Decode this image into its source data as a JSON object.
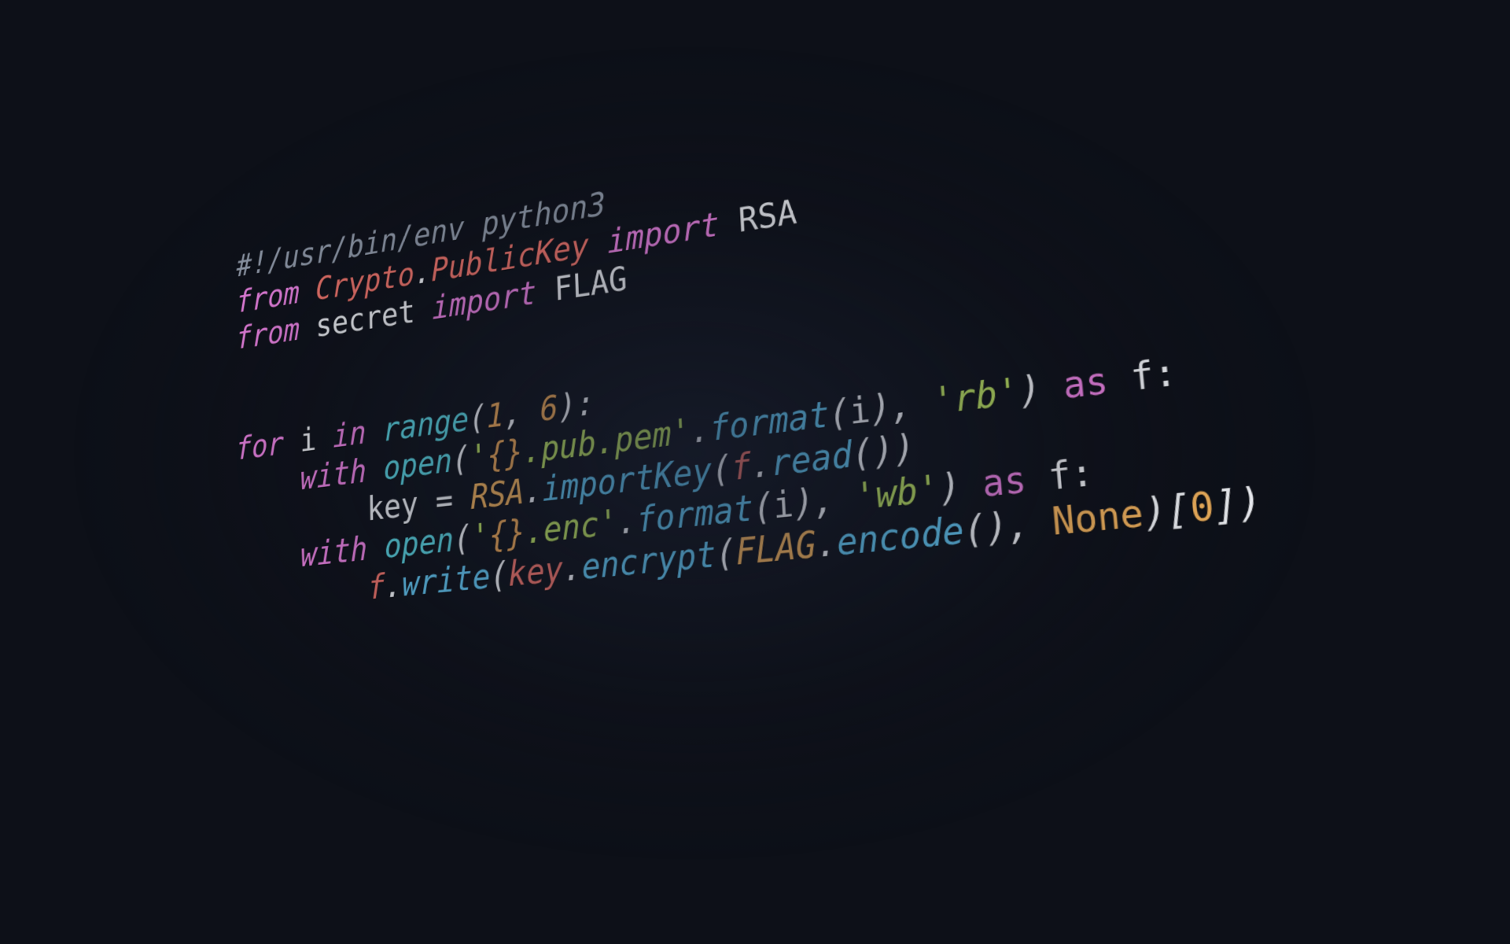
{
  "app": {
    "kind": "code-screenshot",
    "language": "Python",
    "background_color": "#0d1018"
  },
  "palette": {
    "background": "#0d1018",
    "comment": "#a9b3c4",
    "keyword": "#ef84e6",
    "module": "#f4766c",
    "variable": "#f4766c",
    "plain": "#f2f4f8",
    "function": "#63c9f5",
    "builtin": "#5ad6e3",
    "string": "#bce261",
    "format_brace": "#f0a957",
    "number": "#f0a957",
    "constant": "#f7b55d",
    "classname": "#f7b55d",
    "punctuation": "#f4f6fa"
  },
  "code": {
    "full_text": "#!/usr/bin/env python3\nfrom Crypto.PublicKey import RSA\nfrom secret import FLAG\n\n\nfor i in range(1, 6):\n    with open('{}.pub.pem'.format(i), 'rb') as f:\n        key = RSA.importKey(f.read())\n    with open('{}.enc'.format(i), 'wb') as f:\n        f.write(key.encrypt(FLAG.encode(), None)[0])",
    "lines": [
      {
        "n": 1,
        "text": "#!/usr/bin/env python3",
        "tokens": [
          {
            "t": "#!/usr/bin/env python3",
            "c": "comment"
          }
        ]
      },
      {
        "n": 2,
        "text": "from Crypto.PublicKey import RSA",
        "tokens": [
          {
            "t": "from",
            "c": "keyword"
          },
          {
            "t": " ",
            "c": "plain"
          },
          {
            "t": "Crypto",
            "c": "module"
          },
          {
            "t": ".",
            "c": "punct"
          },
          {
            "t": "PublicKey",
            "c": "module"
          },
          {
            "t": " ",
            "c": "plain"
          },
          {
            "t": "import",
            "c": "keyword"
          },
          {
            "t": " ",
            "c": "plain"
          },
          {
            "t": "RSA",
            "c": "plainup"
          }
        ]
      },
      {
        "n": 3,
        "text": "from secret import FLAG",
        "tokens": [
          {
            "t": "from",
            "c": "keyword"
          },
          {
            "t": " ",
            "c": "plain"
          },
          {
            "t": "secret",
            "c": "plainup"
          },
          {
            "t": " ",
            "c": "plain"
          },
          {
            "t": "import",
            "c": "keyword"
          },
          {
            "t": " ",
            "c": "plain"
          },
          {
            "t": "FLAG",
            "c": "plainup"
          }
        ]
      },
      {
        "n": 4,
        "text": "",
        "tokens": []
      },
      {
        "n": 5,
        "text": "",
        "tokens": []
      },
      {
        "n": 6,
        "text": "for i in range(1, 6):",
        "tokens": [
          {
            "t": "for",
            "c": "keyword"
          },
          {
            "t": " ",
            "c": "plain"
          },
          {
            "t": "i",
            "c": "plainup"
          },
          {
            "t": " ",
            "c": "plain"
          },
          {
            "t": "in",
            "c": "keyword"
          },
          {
            "t": " ",
            "c": "plain"
          },
          {
            "t": "range",
            "c": "builtin"
          },
          {
            "t": "(",
            "c": "punct"
          },
          {
            "t": "1",
            "c": "number"
          },
          {
            "t": ", ",
            "c": "punct"
          },
          {
            "t": "6",
            "c": "number"
          },
          {
            "t": "):",
            "c": "punct"
          }
        ]
      },
      {
        "n": 7,
        "text": "    with open('{}.pub.pem'.format(i), 'rb') as f:",
        "tokens": [
          {
            "t": "    ",
            "c": "plain"
          },
          {
            "t": "with",
            "c": "keyword"
          },
          {
            "t": " ",
            "c": "plain"
          },
          {
            "t": "open",
            "c": "builtin"
          },
          {
            "t": "(",
            "c": "punct"
          },
          {
            "t": "'",
            "c": "string"
          },
          {
            "t": "{}",
            "c": "brace"
          },
          {
            "t": ".pub.pem",
            "c": "string"
          },
          {
            "t": "'",
            "c": "string"
          },
          {
            "t": ".",
            "c": "punct"
          },
          {
            "t": "format",
            "c": "func"
          },
          {
            "t": "(",
            "c": "punct"
          },
          {
            "t": "i",
            "c": "plainup"
          },
          {
            "t": "), ",
            "c": "punct"
          },
          {
            "t": "'rb'",
            "c": "string"
          },
          {
            "t": ") ",
            "c": "punct"
          },
          {
            "t": "as",
            "c": "keyword2"
          },
          {
            "t": " ",
            "c": "plain"
          },
          {
            "t": "f:",
            "c": "plainup"
          }
        ]
      },
      {
        "n": 8,
        "text": "        key = RSA.importKey(f.read())",
        "tokens": [
          {
            "t": "        ",
            "c": "plain"
          },
          {
            "t": "key",
            "c": "plainup"
          },
          {
            "t": " = ",
            "c": "punct"
          },
          {
            "t": "RSA",
            "c": "class"
          },
          {
            "t": ".",
            "c": "punct"
          },
          {
            "t": "importKey",
            "c": "func"
          },
          {
            "t": "(",
            "c": "punct"
          },
          {
            "t": "f",
            "c": "var"
          },
          {
            "t": ".",
            "c": "punct"
          },
          {
            "t": "read",
            "c": "func"
          },
          {
            "t": "())",
            "c": "punct"
          }
        ]
      },
      {
        "n": 9,
        "text": "    with open('{}.enc'.format(i), 'wb') as f:",
        "tokens": [
          {
            "t": "    ",
            "c": "plain"
          },
          {
            "t": "with",
            "c": "keyword"
          },
          {
            "t": " ",
            "c": "plain"
          },
          {
            "t": "open",
            "c": "builtin"
          },
          {
            "t": "(",
            "c": "punct"
          },
          {
            "t": "'",
            "c": "string"
          },
          {
            "t": "{}",
            "c": "brace"
          },
          {
            "t": ".enc",
            "c": "string"
          },
          {
            "t": "'",
            "c": "string"
          },
          {
            "t": ".",
            "c": "punct"
          },
          {
            "t": "format",
            "c": "func"
          },
          {
            "t": "(",
            "c": "punct"
          },
          {
            "t": "i",
            "c": "plainup"
          },
          {
            "t": "), ",
            "c": "punct"
          },
          {
            "t": "'wb'",
            "c": "string"
          },
          {
            "t": ") ",
            "c": "punct"
          },
          {
            "t": "as",
            "c": "keyword2"
          },
          {
            "t": " ",
            "c": "plain"
          },
          {
            "t": "f:",
            "c": "plainup"
          }
        ]
      },
      {
        "n": 10,
        "text": "        f.write(key.encrypt(FLAG.encode(), None)[0])",
        "tokens": [
          {
            "t": "        ",
            "c": "plain"
          },
          {
            "t": "f",
            "c": "var"
          },
          {
            "t": ".",
            "c": "punct"
          },
          {
            "t": "write",
            "c": "func"
          },
          {
            "t": "(",
            "c": "punct"
          },
          {
            "t": "key",
            "c": "var"
          },
          {
            "t": ".",
            "c": "punct"
          },
          {
            "t": "encrypt",
            "c": "func"
          },
          {
            "t": "(",
            "c": "punct"
          },
          {
            "t": "FLAG",
            "c": "class"
          },
          {
            "t": ".",
            "c": "punct"
          },
          {
            "t": "encode",
            "c": "func"
          },
          {
            "t": "(), ",
            "c": "punct"
          },
          {
            "t": "None",
            "c": "const"
          },
          {
            "t": ")[",
            "c": "punct"
          },
          {
            "t": "0",
            "c": "const"
          },
          {
            "t": "])",
            "c": "punct"
          }
        ]
      }
    ]
  }
}
